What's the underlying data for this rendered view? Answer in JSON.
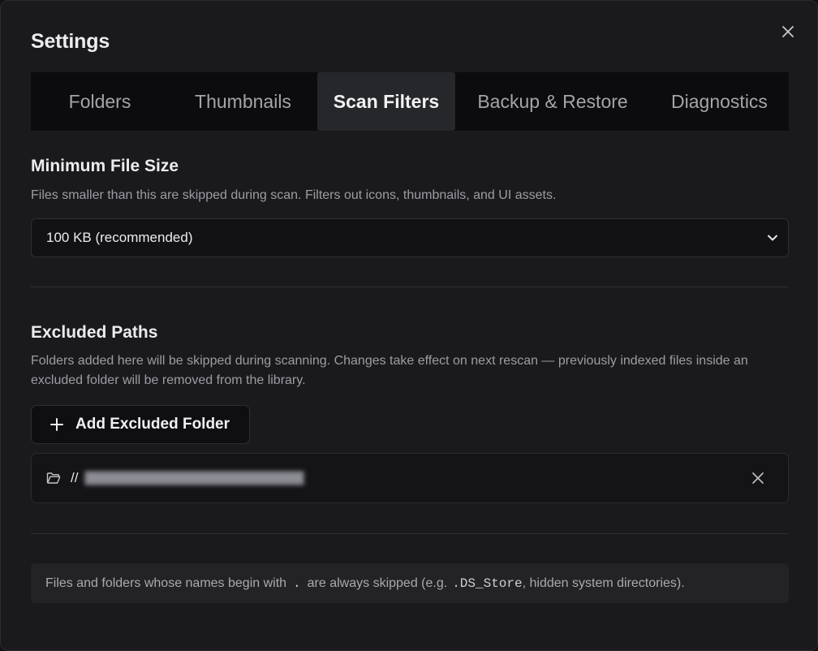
{
  "dialog": {
    "title": "Settings"
  },
  "tabs": [
    {
      "label": "Folders",
      "active": false
    },
    {
      "label": "Thumbnails",
      "active": false
    },
    {
      "label": "Scan Filters",
      "active": true
    },
    {
      "label": "Backup & Restore",
      "active": false
    },
    {
      "label": "Diagnostics",
      "active": false
    }
  ],
  "min_size": {
    "title": "Minimum File Size",
    "description": "Files smaller than this are skipped during scan. Filters out icons, thumbnails, and UI assets.",
    "selected": "100 KB (recommended)"
  },
  "excluded": {
    "title": "Excluded Paths",
    "description": "Folders added here will be skipped during scanning. Changes take effect on next rescan — previously indexed files inside an excluded folder will be removed from the library.",
    "add_label": "Add Excluded Folder",
    "paths": [
      {
        "prefix": "//"
      }
    ]
  },
  "note": {
    "text_before": "Files and folders whose names begin with",
    "dot": ".",
    "text_middle": "are always skipped (e.g.",
    "example": ".DS_Store",
    "text_after": ", hidden system directories)."
  },
  "colors": {
    "background": "#1a1a1d",
    "tab_bar": "#0c0c0e",
    "active_tab": "#26272b"
  }
}
